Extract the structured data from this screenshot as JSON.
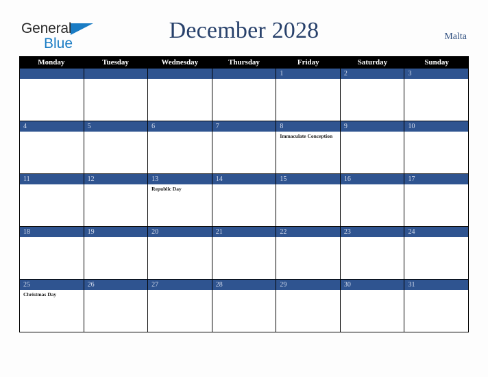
{
  "brand": {
    "word_one": "General",
    "word_two": "Blue",
    "triangle_icon": "triangle-icon",
    "color_dark": "#2b2b2b",
    "color_blue": "#1a7cc4"
  },
  "header": {
    "title": "December 2028",
    "country": "Malta",
    "title_color": "#28416b"
  },
  "calendar": {
    "weekdays": [
      "Monday",
      "Tuesday",
      "Wednesday",
      "Thursday",
      "Friday",
      "Saturday",
      "Sunday"
    ],
    "accent_color": "#2f5490",
    "header_bg": "#000000",
    "weeks": [
      [
        {
          "date": "",
          "holiday": ""
        },
        {
          "date": "",
          "holiday": ""
        },
        {
          "date": "",
          "holiday": ""
        },
        {
          "date": "",
          "holiday": ""
        },
        {
          "date": "1",
          "holiday": ""
        },
        {
          "date": "2",
          "holiday": ""
        },
        {
          "date": "3",
          "holiday": ""
        }
      ],
      [
        {
          "date": "4",
          "holiday": ""
        },
        {
          "date": "5",
          "holiday": ""
        },
        {
          "date": "6",
          "holiday": ""
        },
        {
          "date": "7",
          "holiday": ""
        },
        {
          "date": "8",
          "holiday": "Immaculate Conception"
        },
        {
          "date": "9",
          "holiday": ""
        },
        {
          "date": "10",
          "holiday": ""
        }
      ],
      [
        {
          "date": "11",
          "holiday": ""
        },
        {
          "date": "12",
          "holiday": ""
        },
        {
          "date": "13",
          "holiday": "Republic Day"
        },
        {
          "date": "14",
          "holiday": ""
        },
        {
          "date": "15",
          "holiday": ""
        },
        {
          "date": "16",
          "holiday": ""
        },
        {
          "date": "17",
          "holiday": ""
        }
      ],
      [
        {
          "date": "18",
          "holiday": ""
        },
        {
          "date": "19",
          "holiday": ""
        },
        {
          "date": "20",
          "holiday": ""
        },
        {
          "date": "21",
          "holiday": ""
        },
        {
          "date": "22",
          "holiday": ""
        },
        {
          "date": "23",
          "holiday": ""
        },
        {
          "date": "24",
          "holiday": ""
        }
      ],
      [
        {
          "date": "25",
          "holiday": "Christmas Day"
        },
        {
          "date": "26",
          "holiday": ""
        },
        {
          "date": "27",
          "holiday": ""
        },
        {
          "date": "28",
          "holiday": ""
        },
        {
          "date": "29",
          "holiday": ""
        },
        {
          "date": "30",
          "holiday": ""
        },
        {
          "date": "31",
          "holiday": ""
        }
      ]
    ]
  }
}
